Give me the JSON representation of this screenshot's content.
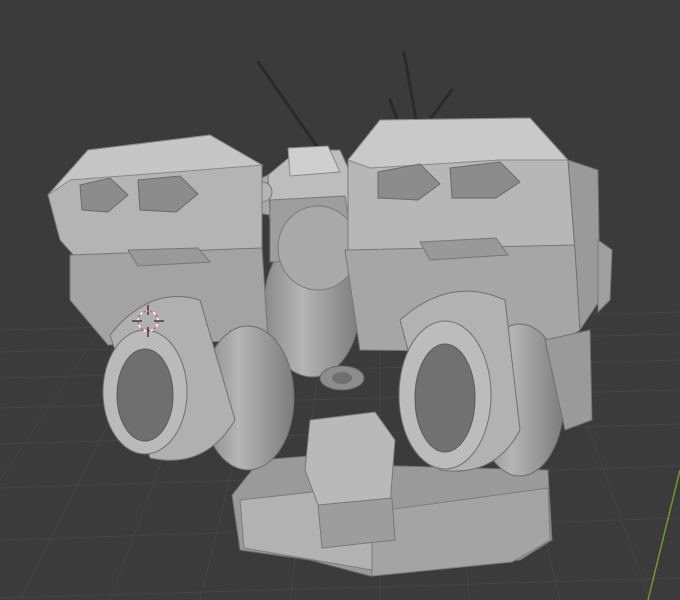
{
  "viewport": {
    "background_color": "#3b3b3b",
    "grid_color": "#454545",
    "axis_x_color": "#8a3a3a",
    "axis_y_color": "#6f9a2b",
    "model_color": "#a6a6a6",
    "model_shadow_color": "#7a7a7a",
    "model_highlight_color": "#c8c8c8",
    "cursor_color": "#e06060",
    "cursor_icon": "3d-cursor-icon"
  }
}
